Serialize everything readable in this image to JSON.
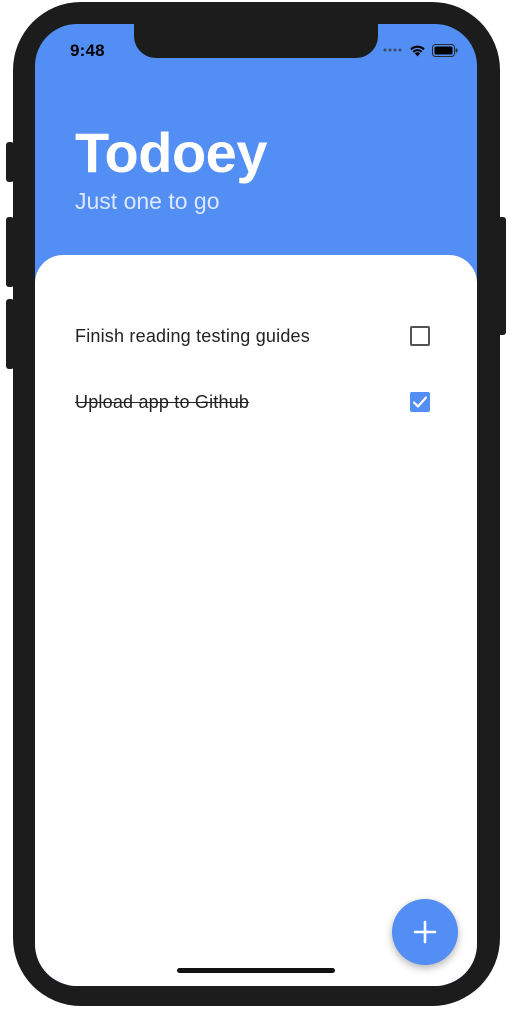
{
  "status_bar": {
    "time": "9:48",
    "icons": [
      "signal-dots-icon",
      "wifi-icon",
      "battery-icon"
    ]
  },
  "header": {
    "title": "Todoey",
    "subtitle": "Just one to go"
  },
  "tasks": [
    {
      "label": "Finish reading testing guides",
      "done": false
    },
    {
      "label": "Upload app to Github",
      "done": true
    }
  ],
  "fab": {
    "icon": "plus-icon"
  },
  "colors": {
    "accent": "#528ef4",
    "background": "#ffffff",
    "text": "#222222"
  }
}
